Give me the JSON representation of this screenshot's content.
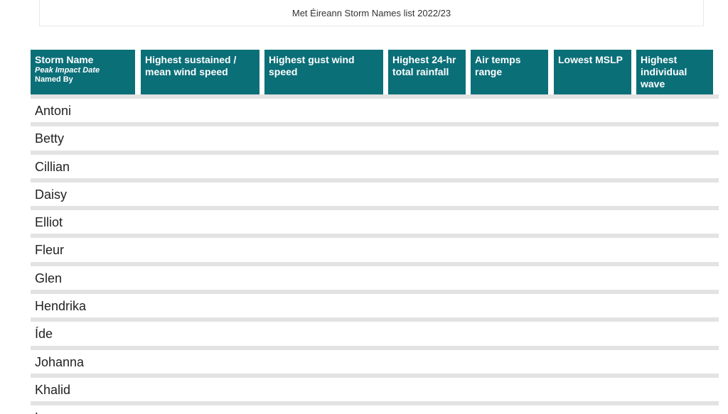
{
  "page_title": "Met Éireann Storm Names list 2022/23",
  "headers": {
    "storm_name": "Storm Name",
    "peak_impact_date": "Peak Impact Date",
    "named_by": "Named By",
    "sustained": "Highest sustained / mean wind speed",
    "gust": "Highest gust wind speed",
    "rainfall": "Highest 24-hr total rainfall",
    "air_temps": "Air temps range",
    "mslp": "Lowest MSLP",
    "wave": "Highest individual wave"
  },
  "storms": [
    "Antoni",
    "Betty",
    "Cillian",
    "Daisy",
    "Elliot",
    "Fleur",
    "Glen",
    "Hendrika",
    "Íde",
    "Johanna",
    "Khalid",
    "L"
  ],
  "colors": {
    "header_bg": "#0b6f78",
    "row_separator": "#e3e3e3"
  }
}
